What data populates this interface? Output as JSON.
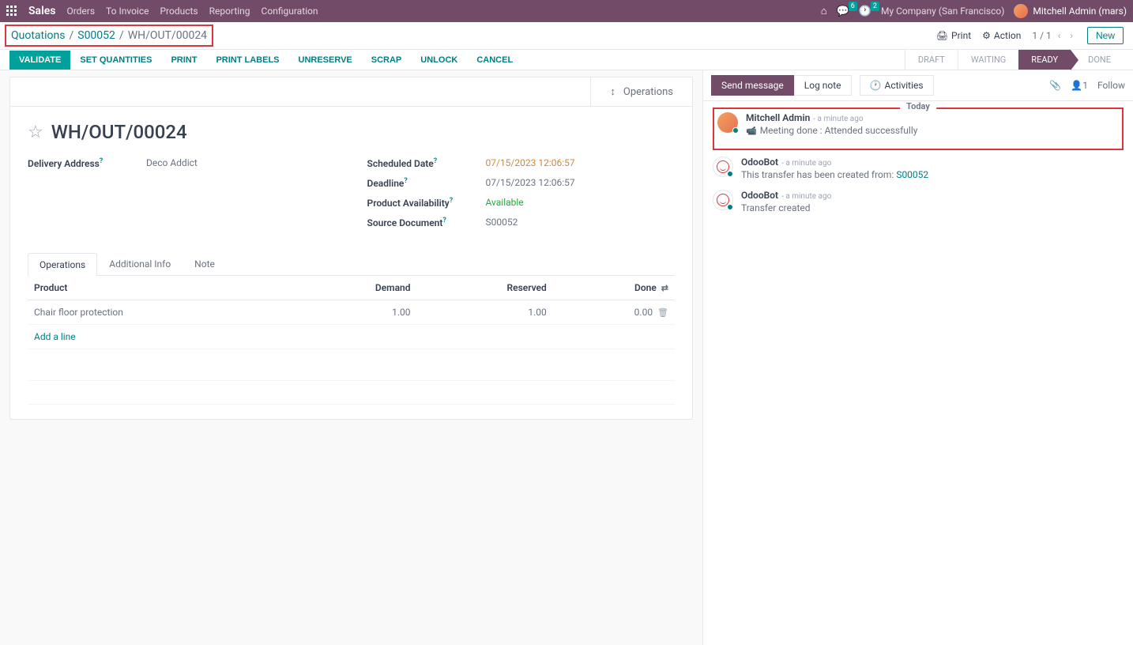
{
  "navbar": {
    "brand": "Sales",
    "links": [
      "Orders",
      "To Invoice",
      "Products",
      "Reporting",
      "Configuration"
    ],
    "msg_badge": "6",
    "activity_badge": "2",
    "company": "My Company (San Francisco)",
    "user": "Mitchell Admin (mars)"
  },
  "breadcrumb": {
    "root": "Quotations",
    "order": "S00052",
    "current": "WH/OUT/00024"
  },
  "controls": {
    "print": "Print",
    "action": "Action",
    "pager": "1 / 1",
    "new": "New"
  },
  "actions": {
    "validate": "VALIDATE",
    "set_qty": "SET QUANTITIES",
    "print": "PRINT",
    "print_labels": "PRINT LABELS",
    "unreserve": "UNRESERVE",
    "scrap": "SCRAP",
    "unlock": "UNLOCK",
    "cancel": "CANCEL"
  },
  "statuses": {
    "draft": "DRAFT",
    "waiting": "WAITING",
    "ready": "READY",
    "done": "DONE"
  },
  "smart": {
    "operations": "Operations"
  },
  "record": {
    "title": "WH/OUT/00024",
    "delivery_address_label": "Delivery Address",
    "delivery_address": "Deco Addict",
    "scheduled_date_label": "Scheduled Date",
    "scheduled_date": "07/15/2023 12:06:57",
    "deadline_label": "Deadline",
    "deadline": "07/15/2023 12:06:57",
    "availability_label": "Product Availability",
    "availability": "Available",
    "source_label": "Source Document",
    "source": "S00052"
  },
  "tabs": {
    "operations": "Operations",
    "additional": "Additional Info",
    "note": "Note"
  },
  "table": {
    "headers": {
      "product": "Product",
      "demand": "Demand",
      "reserved": "Reserved",
      "done": "Done"
    },
    "rows": [
      {
        "product": "Chair floor protection",
        "demand": "1.00",
        "reserved": "1.00",
        "done": "0.00"
      }
    ],
    "add_line": "Add a line"
  },
  "chatter": {
    "send": "Send message",
    "log": "Log note",
    "activities": "Activities",
    "follower_count": "1",
    "follow": "Follow",
    "today": "Today",
    "messages": [
      {
        "author": "Mitchell Admin",
        "time": "a minute ago",
        "body_prefix": "Meeting done : ",
        "body": "Attended successfully",
        "type": "user",
        "icon": "cam"
      },
      {
        "author": "OdooBot",
        "time": "a minute ago",
        "body_prefix": "This transfer has been created from: ",
        "body_link": "S00052",
        "type": "bot"
      },
      {
        "author": "OdooBot",
        "time": "a minute ago",
        "body": "Transfer created",
        "type": "bot"
      }
    ]
  }
}
